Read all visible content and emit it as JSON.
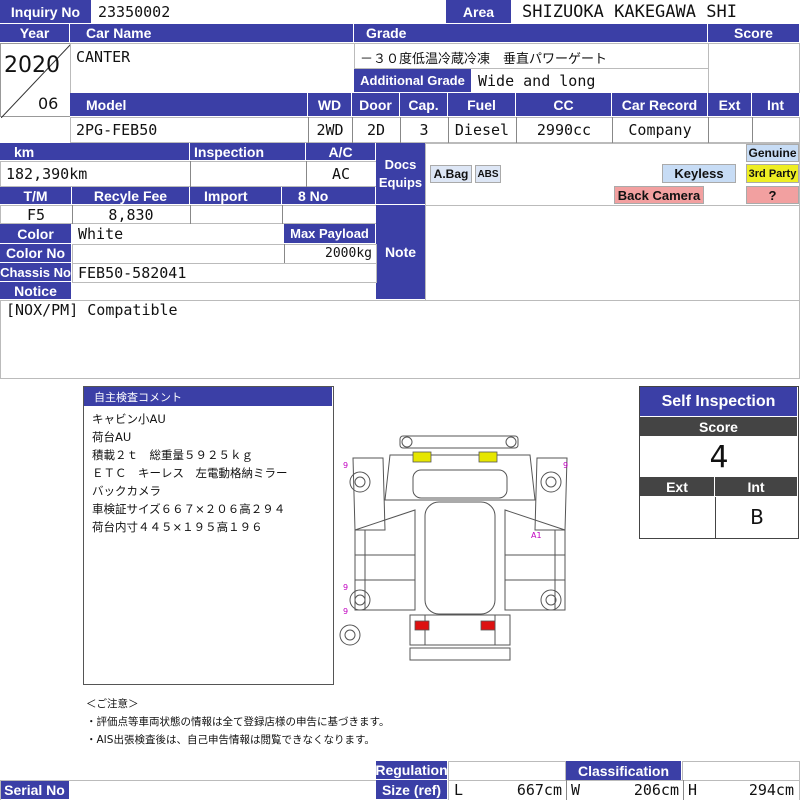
{
  "header": {
    "inquiry_label": "Inquiry No",
    "inquiry_no": "23350002",
    "area_label": "Area",
    "area": "SHIZUOKA KAKEGAWA SHI",
    "year_label": "Year",
    "car_name_label": "Car Name",
    "grade_label": "Grade",
    "score_label": "Score",
    "year": "2020",
    "month": "06",
    "car_name": "CANTER",
    "grade": "－３０度低温冷蔵冷凍　垂直パワーゲート",
    "additional_grade_label": "Additional Grade",
    "additional_grade": "Wide and long"
  },
  "specs": {
    "model_label": "Model",
    "wd_label": "WD",
    "door_label": "Door",
    "cap_label": "Cap.",
    "fuel_label": "Fuel",
    "cc_label": "CC",
    "car_record_label": "Car Record",
    "ext_label": "Ext",
    "int_label": "Int",
    "model": "2PG-FEB50",
    "wd": "2WD",
    "door": "2D",
    "cap": "3",
    "fuel": "Diesel",
    "cc": "2990cc",
    "car_record": "Company"
  },
  "details": {
    "km_label": "km",
    "inspection_label": "Inspection",
    "ac_label": "A/C",
    "km": "182,390km",
    "ac": "AC",
    "tm_label": "T/M",
    "recycle_label": "Recyle Fee",
    "import_label": "Import",
    "eight_no_label": "8 No",
    "tm": "F5",
    "recycle_fee": "8,830",
    "color_label": "Color",
    "color": "White",
    "max_payload_label": "Max Payload",
    "max_payload": "2000kg",
    "color_no_label": "Color No",
    "chassis_label": "Chassis No",
    "chassis_no": "FEB50-582041",
    "notice_label": "Notice",
    "notice": "[NOX/PM] Compatible"
  },
  "equips": {
    "docs_label": "Docs\nEquips",
    "abag": "A.Bag",
    "abs": "ABS",
    "keyless": "Keyless",
    "back_camera": "Back Camera",
    "genuine": "Genuine",
    "third_party": "3rd Party",
    "unknown": "?",
    "note_label": "Note"
  },
  "comment": {
    "title": "自主検査コメント",
    "lines": [
      "キャビン小AU",
      "荷台AU",
      "積載２ｔ　総重量５９２５ｋｇ",
      "ＥＴＣ　キーレス　左電動格納ミラー",
      "バックカメラ",
      "車検証サイズ６６７×２０６高２９４",
      "荷台内寸４４５×１９５高１９６"
    ]
  },
  "diagram": {
    "marks": [
      "9",
      "9",
      "9",
      "9",
      "A1"
    ]
  },
  "self_inspection": {
    "title": "Self Inspection",
    "score_label": "Score",
    "score": "4",
    "ext_label": "Ext",
    "int_label": "Int",
    "ext": "",
    "int": "B"
  },
  "notes": {
    "head": "＜ご注意＞",
    "line1": "・評価点等車両状態の情報は全て登録店様の申告に基づきます。",
    "line2": "・AIS出張検査後は、自己申告情報は閲覧できなくなります。"
  },
  "footer": {
    "serial_label": "Serial No",
    "regulation_label": "Regulation",
    "size_label": "Size (ref)",
    "classification_label": "Classification",
    "l_label": "L",
    "l": "667cm",
    "w_label": "W",
    "w": "206cm",
    "h_label": "H",
    "h": "294cm"
  },
  "colors": {
    "header_bg": "#3b3fa6",
    "yellow_part": "#e6e600",
    "red_part": "#dd1111",
    "mark": "#c000c0"
  }
}
